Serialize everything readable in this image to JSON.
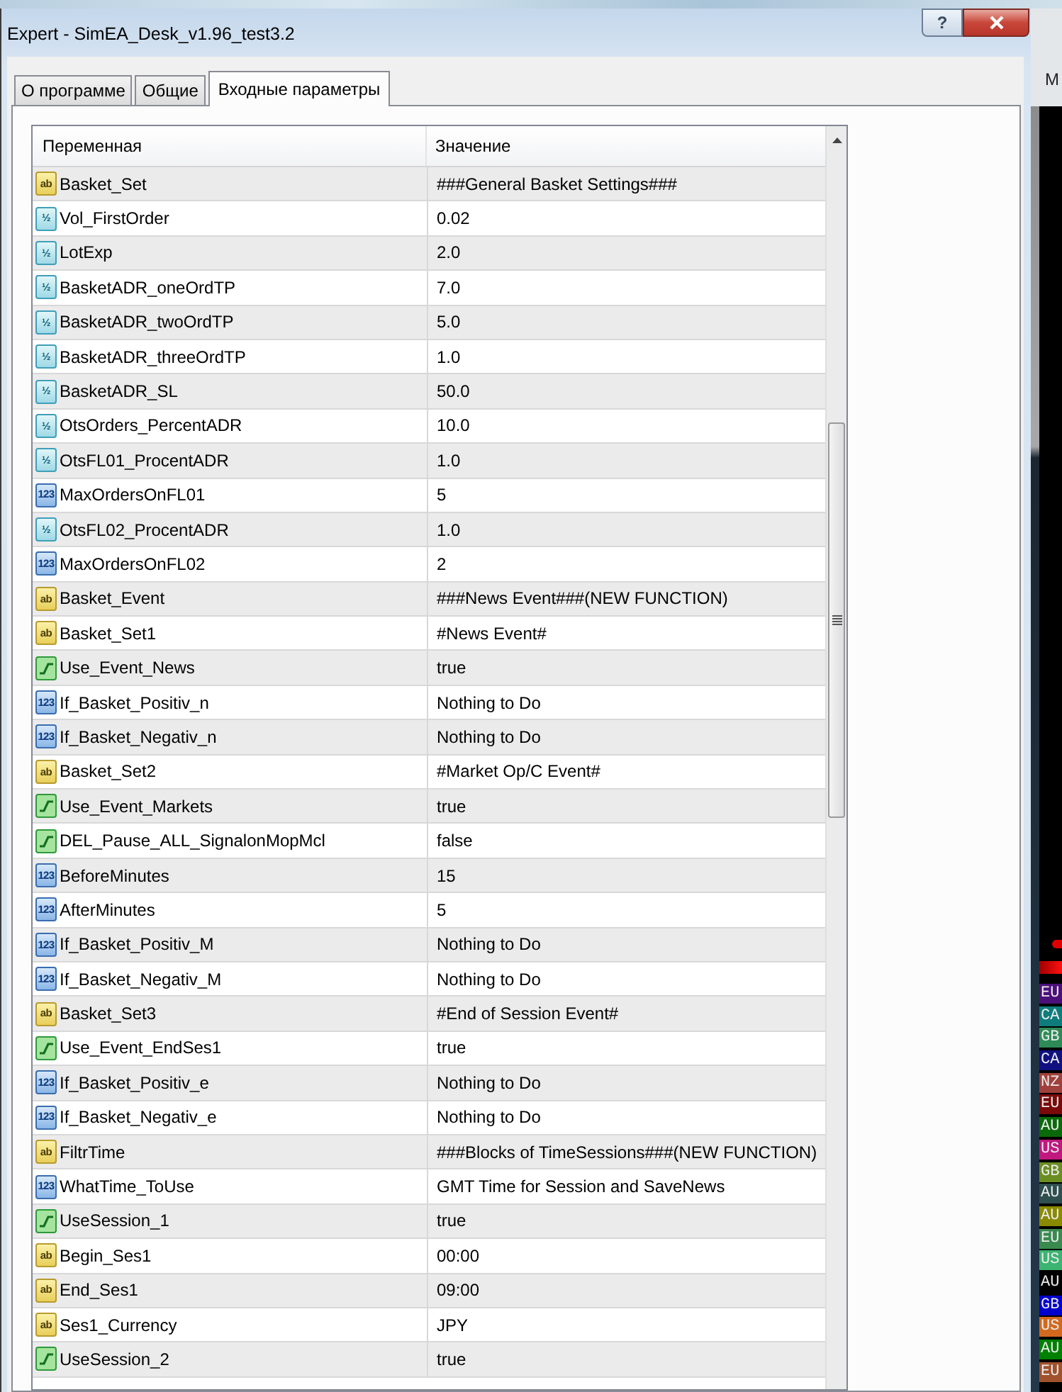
{
  "window": {
    "title": "Expert - SimEA_Desk_v1.96_test3.2",
    "help_label": "?"
  },
  "tabs": [
    {
      "label": "О программе",
      "selected": false
    },
    {
      "label": "Общие",
      "selected": false
    },
    {
      "label": "Входные параметры",
      "selected": true
    }
  ],
  "table": {
    "columns": [
      "Переменная",
      "Значение"
    ],
    "rows": [
      {
        "kind": "string",
        "icon_text": "ab",
        "name": "Basket_Set",
        "value": "###General Basket Settings###"
      },
      {
        "kind": "double",
        "icon_text": "½",
        "name": "Vol_FirstOrder",
        "value": "0.02"
      },
      {
        "kind": "double",
        "icon_text": "½",
        "name": "LotExp",
        "value": "2.0"
      },
      {
        "kind": "double",
        "icon_text": "½",
        "name": "BasketADR_oneOrdTP",
        "value": "7.0"
      },
      {
        "kind": "double",
        "icon_text": "½",
        "name": "BasketADR_twoOrdTP",
        "value": "5.0"
      },
      {
        "kind": "double",
        "icon_text": "½",
        "name": "BasketADR_threeOrdTP",
        "value": "1.0"
      },
      {
        "kind": "double",
        "icon_text": "½",
        "name": "BasketADR_SL",
        "value": "50.0"
      },
      {
        "kind": "double",
        "icon_text": "½",
        "name": "OtsOrders_PercentADR",
        "value": "10.0"
      },
      {
        "kind": "double",
        "icon_text": "½",
        "name": "OtsFL01_ProcentADR",
        "value": "1.0"
      },
      {
        "kind": "int",
        "icon_text": "123",
        "name": "MaxOrdersOnFL01",
        "value": "5"
      },
      {
        "kind": "double",
        "icon_text": "½",
        "name": "OtsFL02_ProcentADR",
        "value": "1.0"
      },
      {
        "kind": "int",
        "icon_text": "123",
        "name": "MaxOrdersOnFL02",
        "value": "2"
      },
      {
        "kind": "string",
        "icon_text": "ab",
        "name": "Basket_Event",
        "value": "###News Event###(NEW FUNCTION)"
      },
      {
        "kind": "string",
        "icon_text": "ab",
        "name": "Basket_Set1",
        "value": "#News Event#"
      },
      {
        "kind": "bool",
        "name": "Use_Event_News",
        "value": "true"
      },
      {
        "kind": "int",
        "icon_text": "123",
        "name": "If_Basket_Positiv_n",
        "value": "Nothing to Do"
      },
      {
        "kind": "int",
        "icon_text": "123",
        "name": "If_Basket_Negativ_n",
        "value": "Nothing to Do"
      },
      {
        "kind": "string",
        "icon_text": "ab",
        "name": "Basket_Set2",
        "value": "#Market Op/C Event#"
      },
      {
        "kind": "bool",
        "name": "Use_Event_Markets",
        "value": "true"
      },
      {
        "kind": "bool",
        "name": "DEL_Pause_ALL_SignalonMopMcl",
        "value": "false"
      },
      {
        "kind": "int",
        "icon_text": "123",
        "name": "BeforeMinutes",
        "value": "15"
      },
      {
        "kind": "int",
        "icon_text": "123",
        "name": "AfterMinutes",
        "value": "5"
      },
      {
        "kind": "int",
        "icon_text": "123",
        "name": "If_Basket_Positiv_M",
        "value": "Nothing to Do"
      },
      {
        "kind": "int",
        "icon_text": "123",
        "name": "If_Basket_Negativ_M",
        "value": "Nothing to Do"
      },
      {
        "kind": "string",
        "icon_text": "ab",
        "name": "Basket_Set3",
        "value": "#End of Session Event#"
      },
      {
        "kind": "bool",
        "name": "Use_Event_EndSes1",
        "value": "true"
      },
      {
        "kind": "int",
        "icon_text": "123",
        "name": "If_Basket_Positiv_e",
        "value": "Nothing to Do"
      },
      {
        "kind": "int",
        "icon_text": "123",
        "name": "If_Basket_Negativ_e",
        "value": "Nothing to Do"
      },
      {
        "kind": "string",
        "icon_text": "ab",
        "name": "FiltrTime",
        "value": "###Blocks of TimeSessions###(NEW FUNCTION)"
      },
      {
        "kind": "int",
        "icon_text": "123",
        "name": "WhatTime_ToUse",
        "value": "GMT Time for Session and SaveNews"
      },
      {
        "kind": "bool",
        "name": "UseSession_1",
        "value": "true"
      },
      {
        "kind": "string",
        "icon_text": "ab",
        "name": "Begin_Ses1",
        "value": "00:00"
      },
      {
        "kind": "string",
        "icon_text": "ab",
        "name": "End_Ses1",
        "value": "09:00"
      },
      {
        "kind": "string",
        "icon_text": "ab",
        "name": "Ses1_Currency",
        "value": "JPY"
      },
      {
        "kind": "bool",
        "name": "UseSession_2",
        "value": "true"
      }
    ]
  },
  "background_app": {
    "menu_text": "M",
    "currency_labels": [
      {
        "label": "EU",
        "color": "#4b0f7a"
      },
      {
        "label": "CA",
        "color": "#0e7c7b"
      },
      {
        "label": "GB",
        "color": "#2e8b57"
      },
      {
        "label": "CA",
        "color": "#101080"
      },
      {
        "label": "NZ",
        "color": "#a0403c"
      },
      {
        "label": "EU",
        "color": "#7a0a0a"
      },
      {
        "label": "AU",
        "color": "#0a6a0a"
      },
      {
        "label": "US",
        "color": "#c0187f"
      },
      {
        "label": "GB",
        "color": "#6b8e23"
      },
      {
        "label": "AU",
        "color": "#2f4f4f"
      },
      {
        "label": "AU",
        "color": "#8a8a00"
      },
      {
        "label": "EU",
        "color": "#3a8a50"
      },
      {
        "label": "US",
        "color": "#3cb371"
      },
      {
        "label": "AU",
        "color": "#000000"
      },
      {
        "label": "GB",
        "color": "#0000cd"
      },
      {
        "label": "US",
        "color": "#d2691e"
      },
      {
        "label": "AU",
        "color": "#008000"
      },
      {
        "label": "EU",
        "color": "#a0522d"
      }
    ]
  }
}
